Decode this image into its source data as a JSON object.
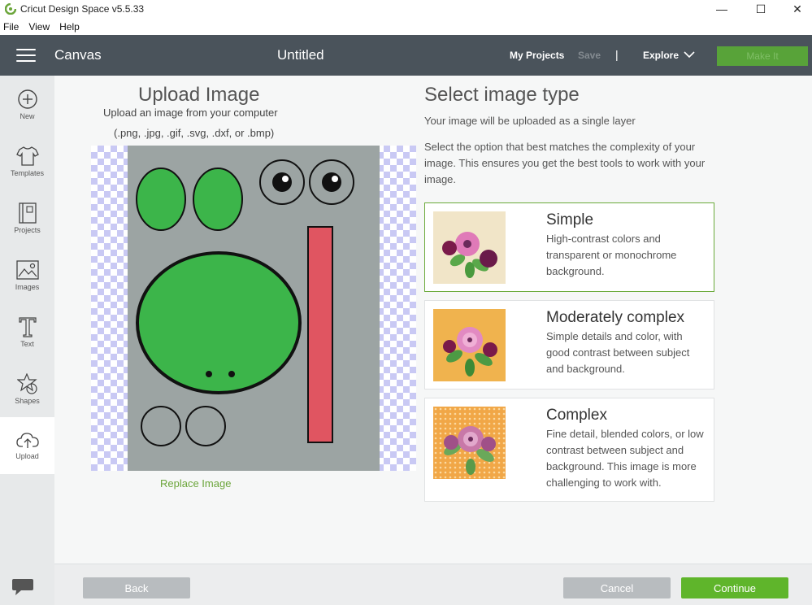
{
  "window": {
    "title": "Cricut Design Space  v5.5.33",
    "minimize": "—",
    "maximize": "☐",
    "close": "✕"
  },
  "menu": {
    "items": [
      "File",
      "View",
      "Help"
    ]
  },
  "appbar": {
    "canvas": "Canvas",
    "doc_title": "Untitled",
    "my_projects": "My Projects",
    "save": "Save",
    "separator": "|",
    "explore": "Explore",
    "make_it": "Make It"
  },
  "sidebar": {
    "items": [
      {
        "label": "New",
        "icon": "plus-circle-icon"
      },
      {
        "label": "Templates",
        "icon": "tshirt-icon"
      },
      {
        "label": "Projects",
        "icon": "projects-icon"
      },
      {
        "label": "Images",
        "icon": "image-icon"
      },
      {
        "label": "Text",
        "icon": "text-icon"
      },
      {
        "label": "Shapes",
        "icon": "shapes-icon"
      },
      {
        "label": "Upload",
        "icon": "cloud-upload-icon"
      }
    ]
  },
  "upload": {
    "title": "Upload Image",
    "subtitle": "Upload an image from your computer",
    "formats": "(.png, .jpg, .gif, .svg, .dxf, or .bmp)",
    "replace": "Replace Image"
  },
  "select": {
    "title": "Select image type",
    "line1": "Your image will be uploaded as a single layer",
    "description": "Select the option that best matches the complexity of your image. This ensures you get the best tools to work with your image.",
    "options": [
      {
        "title": "Simple",
        "desc": "High-contrast colors and transparent or monochrome background.",
        "selected": true
      },
      {
        "title": "Moderately complex",
        "desc": "Simple details and color, with good contrast between subject and background.",
        "selected": false
      },
      {
        "title": "Complex",
        "desc": "Fine detail, blended colors, or low contrast between subject and background. This image is more challenging to work with.",
        "selected": false
      }
    ]
  },
  "footer": {
    "back": "Back",
    "cancel": "Cancel",
    "continue": "Continue"
  },
  "colors": {
    "appbar": "#4a535b",
    "accent_green": "#5fb52b",
    "preview_gray": "#9ca4a3",
    "shape_green": "#3cb54a",
    "shape_red": "#e05561"
  }
}
